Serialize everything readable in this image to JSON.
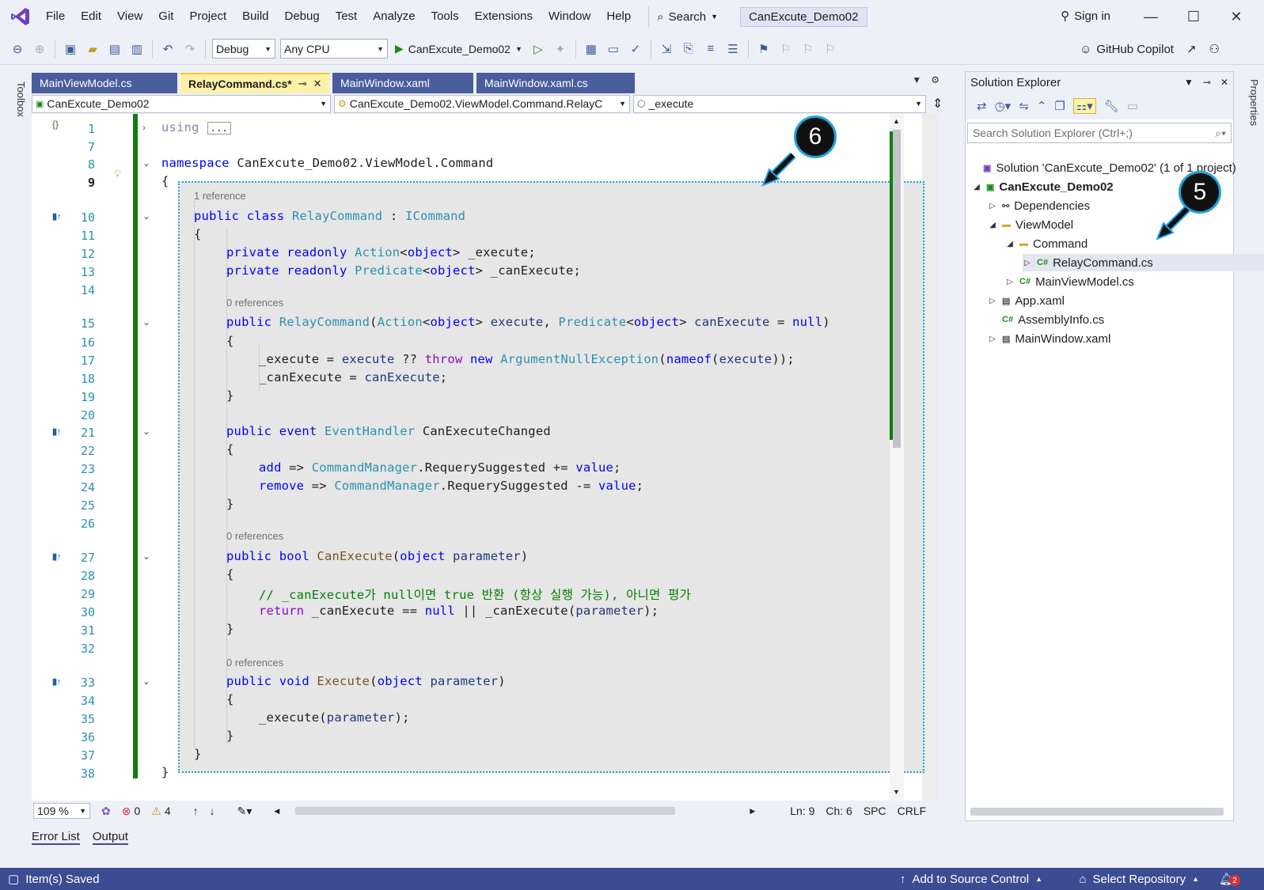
{
  "menubar": {
    "items": [
      "File",
      "Edit",
      "View",
      "Git",
      "Project",
      "Build",
      "Debug",
      "Test",
      "Analyze",
      "Tools",
      "Extensions",
      "Window",
      "Help"
    ],
    "search_label": "Search",
    "title_badge": "CanExcute_Demo02",
    "sign_in": "Sign in"
  },
  "toolbar": {
    "config": "Debug",
    "platform": "Any CPU",
    "run_target": "CanExcute_Demo02",
    "copilot": "GitHub Copilot"
  },
  "side_strips": {
    "toolbox": "Toolbox",
    "properties": "Properties"
  },
  "tabs": [
    {
      "label": "MainViewModel.cs",
      "active": false
    },
    {
      "label": "RelayCommand.cs*",
      "active": true
    },
    {
      "label": "MainWindow.xaml",
      "active": false
    },
    {
      "label": "MainWindow.xaml.cs",
      "active": false
    }
  ],
  "navbar": {
    "project": "CanExcute_Demo02",
    "type": "CanExcute_Demo02.ViewModel.Command.RelayC",
    "member": "_execute"
  },
  "editor": {
    "lens_1ref": "1 reference",
    "lens_0ref": "0 references",
    "collapsed_using": "using",
    "collapsed_dots": "...",
    "line_numbers": [
      "1",
      "7",
      "8",
      "9",
      "10",
      "11",
      "12",
      "13",
      "14",
      "15",
      "16",
      "17",
      "18",
      "19",
      "20",
      "21",
      "22",
      "23",
      "24",
      "25",
      "26",
      "27",
      "28",
      "29",
      "30",
      "31",
      "32",
      "33",
      "34",
      "35",
      "36",
      "37",
      "38"
    ]
  },
  "editor_status": {
    "zoom": "109 %",
    "errors": "0",
    "warnings": "4",
    "ln": "Ln: 9",
    "ch": "Ch: 6",
    "spc": "SPC",
    "crlf": "CRLF"
  },
  "bottom_tabs": [
    "Error List",
    "Output"
  ],
  "statusbar": {
    "saved": "Item(s) Saved",
    "add_source": "Add to Source Control",
    "select_repo": "Select Repository",
    "notif_count": "2"
  },
  "solution_explorer": {
    "title": "Solution Explorer",
    "search_placeholder": "Search Solution Explorer (Ctrl+;)",
    "items": [
      {
        "label": "Solution 'CanExcute_Demo02' (1 of 1 project)",
        "icon": "solution-icon"
      },
      {
        "label": "CanExcute_Demo02",
        "icon": "project-icon"
      },
      {
        "label": "Dependencies",
        "icon": "dependencies-icon"
      },
      {
        "label": "ViewModel",
        "icon": "folder-icon"
      },
      {
        "label": "Command",
        "icon": "folder-icon"
      },
      {
        "label": "RelayCommand.cs",
        "icon": "csharp-file-icon"
      },
      {
        "label": "MainViewModel.cs",
        "icon": "csharp-file-icon"
      },
      {
        "label": "App.xaml",
        "icon": "xaml-file-icon"
      },
      {
        "label": "AssemblyInfo.cs",
        "icon": "csharp-file-icon"
      },
      {
        "label": "MainWindow.xaml",
        "icon": "xaml-file-icon"
      }
    ]
  },
  "callouts": {
    "a": "6",
    "b": "5"
  },
  "colors": {
    "accent": "#3c4c92",
    "selection_border": "#1fa4e0",
    "change_bar": "#107c10"
  }
}
